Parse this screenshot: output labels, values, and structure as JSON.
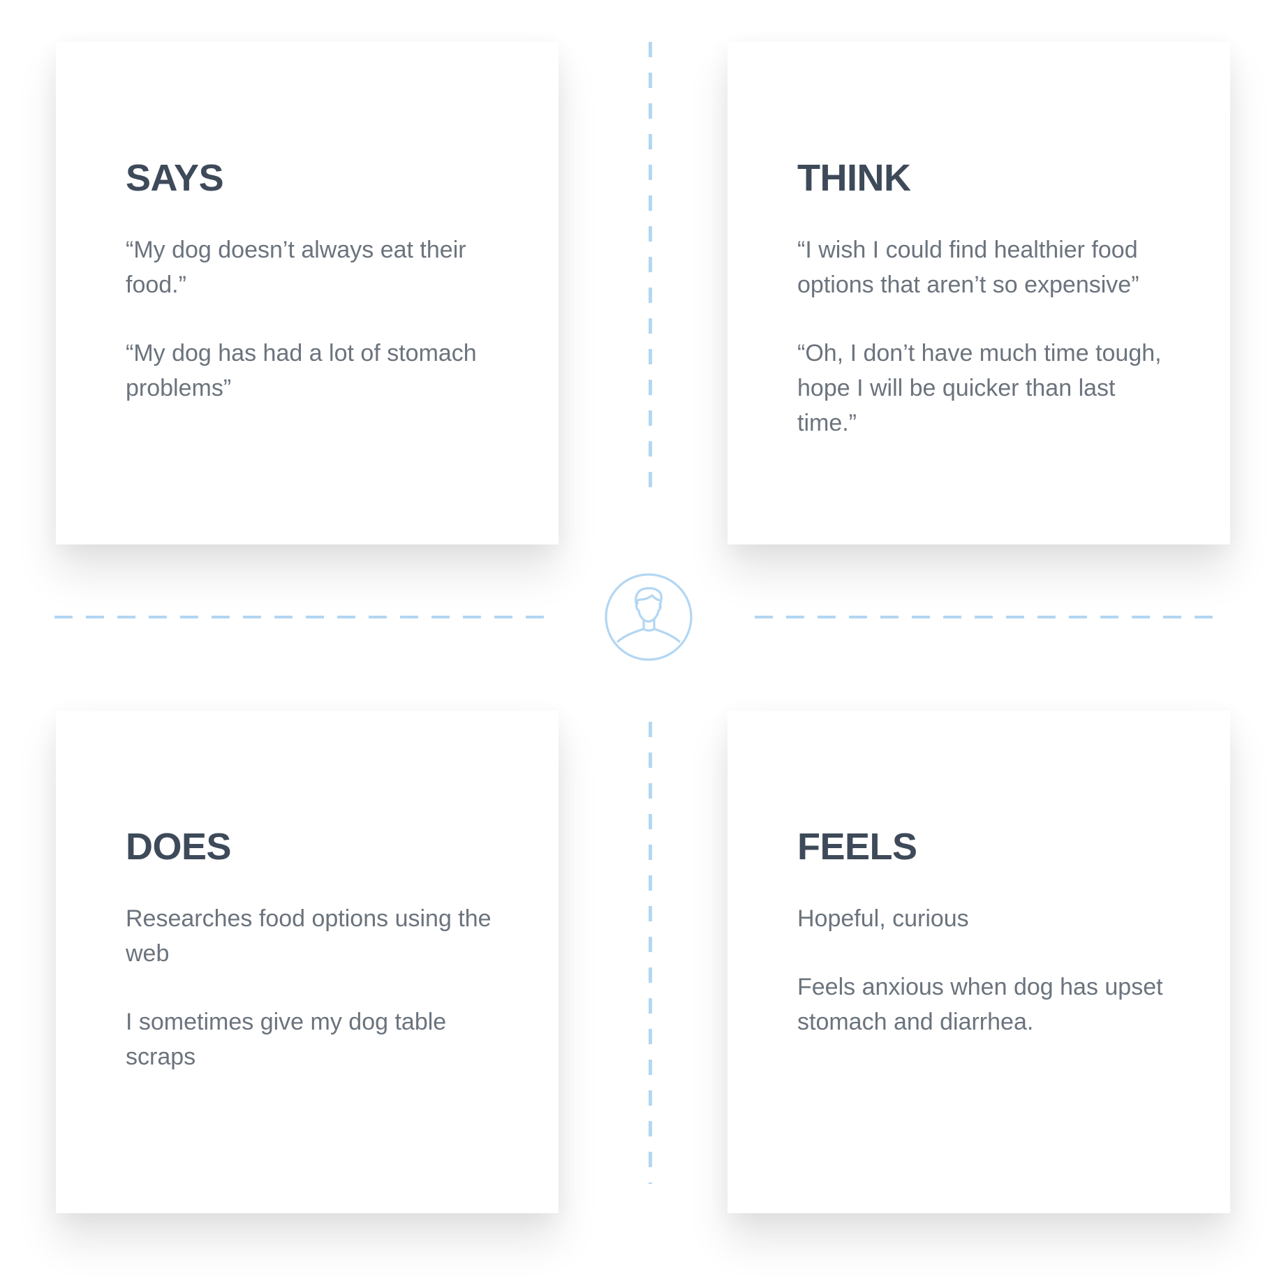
{
  "quadrants": {
    "says": {
      "title": "SAYS",
      "items": [
        "“My dog doesn’t always eat their food.”",
        "“My dog has had a lot of stomach problems”"
      ]
    },
    "think": {
      "title": "THINK",
      "items": [
        "“I wish I could find healthier food options that aren’t so expensive”",
        "“Oh, I don’t have much time tough, hope I will be quicker than last time.”"
      ]
    },
    "does": {
      "title": "DOES",
      "items": [
        "Researches food options using the web",
        "I sometimes give my dog table scraps"
      ]
    },
    "feels": {
      "title": "FEELS",
      "items": [
        "Hopeful, curious",
        "Feels anxious when dog has upset stomach and diarrhea."
      ]
    }
  },
  "center": {
    "icon": "user-avatar-icon"
  },
  "colors": {
    "title": "#3e4a59",
    "text": "#6b737d",
    "accent": "#b3d6f3"
  }
}
